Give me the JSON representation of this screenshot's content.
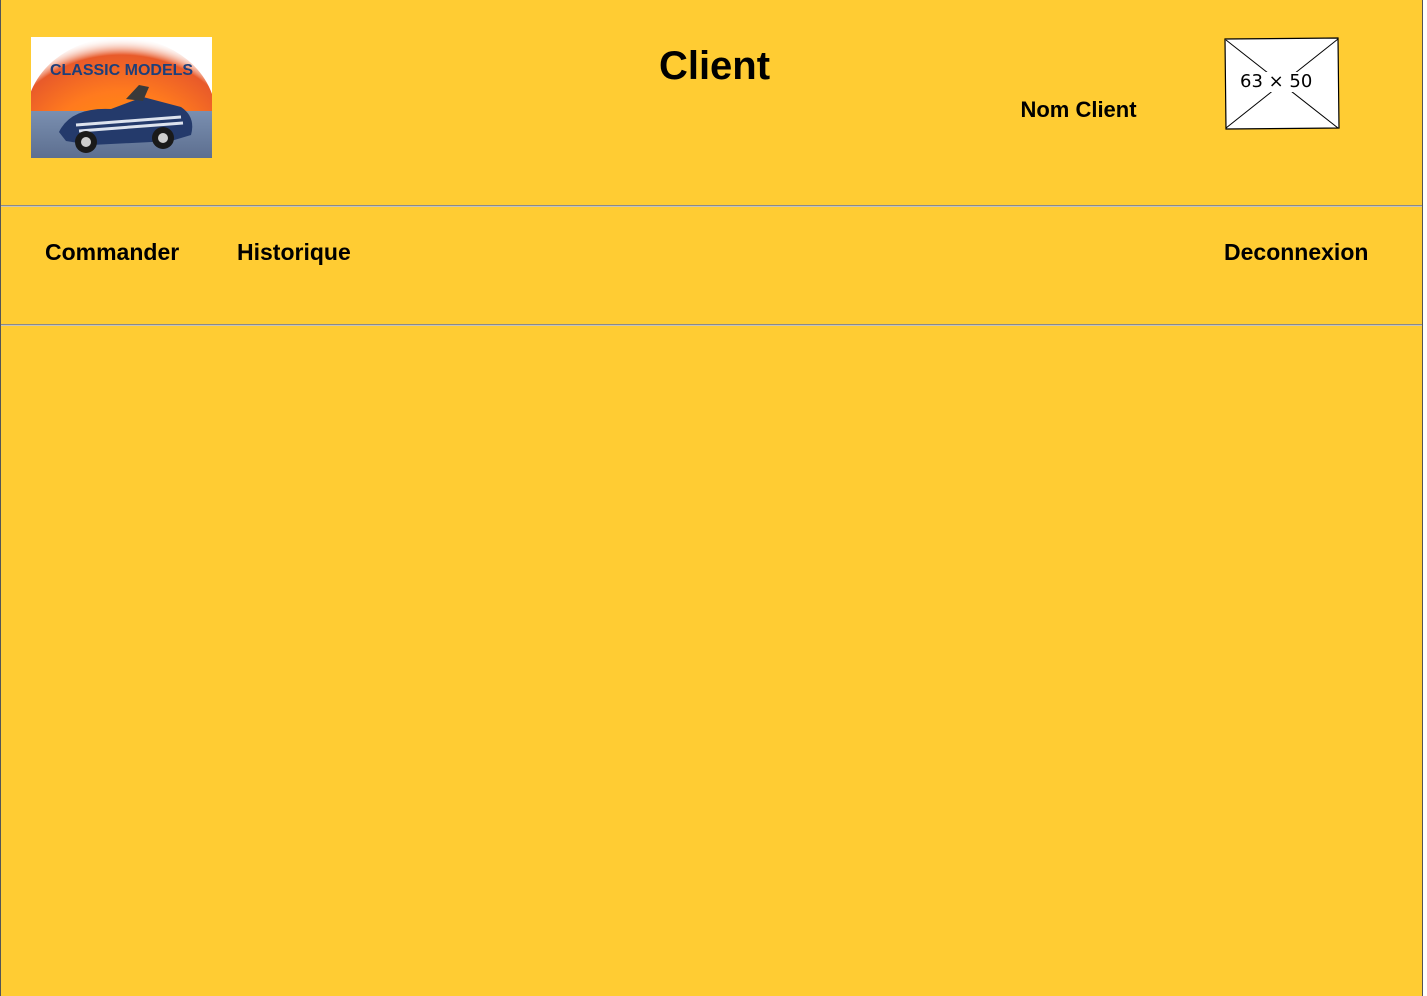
{
  "header": {
    "logo_text": "CLASSIC MODELS",
    "title": "Client",
    "client_name": "Nom Client",
    "image_placeholder": "63 × 50"
  },
  "nav": {
    "order": "Commander",
    "history": "Historique",
    "logout": "Deconnexion"
  },
  "colors": {
    "background": "#ffcc33",
    "text": "#000000"
  }
}
